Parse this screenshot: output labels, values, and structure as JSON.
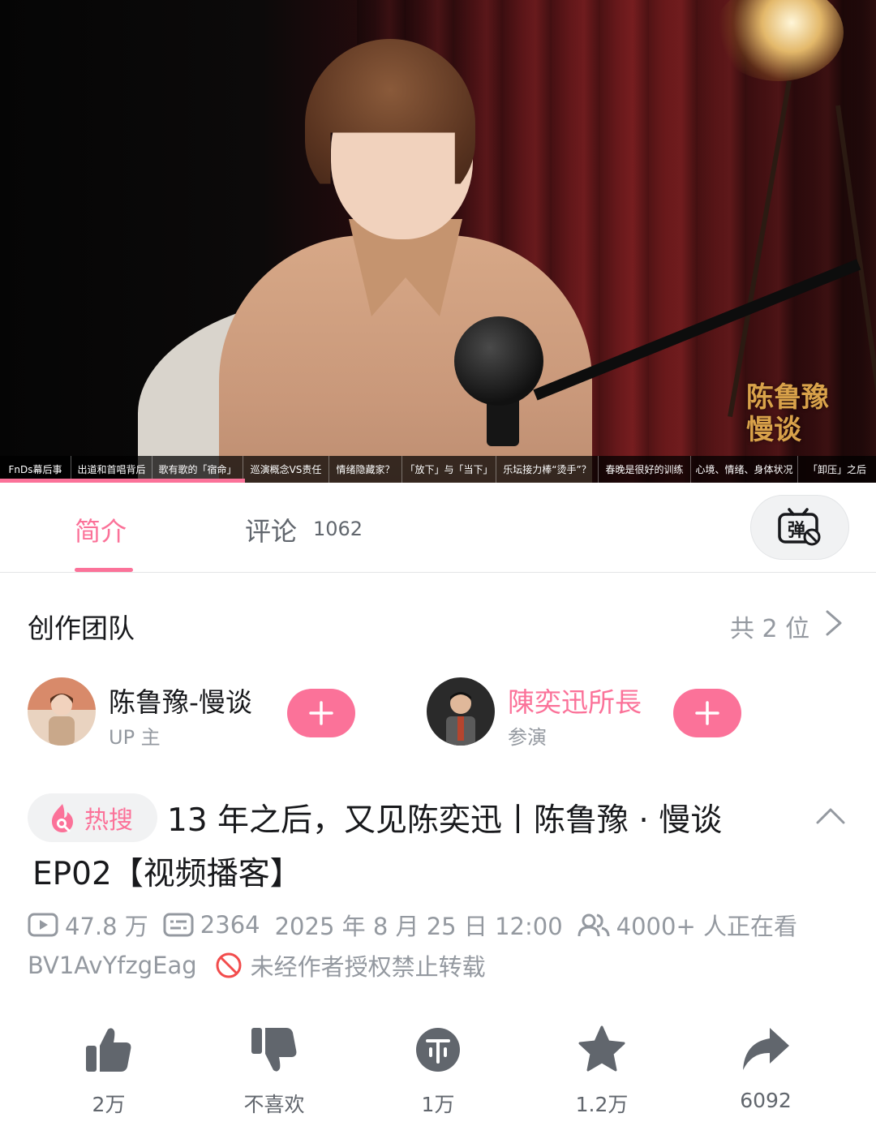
{
  "video": {
    "brand_logo_text": "陈鲁豫慢谈",
    "chapters": [
      {
        "label": "FnDs幕后事",
        "active": true
      },
      {
        "label": "出道和首唱背后",
        "active": false
      },
      {
        "label": "歌有歌的「宿命」",
        "active": false
      },
      {
        "label": "巡演概念VS责任",
        "active": false
      },
      {
        "label": "情绪隐藏家？",
        "active": false
      },
      {
        "label": "「放下」与「当下」",
        "active": false
      },
      {
        "label": "乐坛接力棒“烫手”？",
        "active": false
      },
      {
        "label": "春晚是很好的训练",
        "active": false
      },
      {
        "label": "心境、情绪、身体状况",
        "active": false
      },
      {
        "label": "「卸压」之后",
        "active": false
      }
    ],
    "progress": 0.28
  },
  "tabs": {
    "intro_label": "简介",
    "comments_label": "评论",
    "comments_count": "1062",
    "danmaku_icon": "danmaku-icon"
  },
  "team": {
    "title": "创作团队",
    "count_label": "共 2 位",
    "members": [
      {
        "name": "陈鲁豫-慢谈",
        "role": "UP 主",
        "name_color": "#18191c"
      },
      {
        "name": "陳奕迅所長",
        "role": "参演",
        "name_color": "#fb7299"
      }
    ]
  },
  "title": {
    "hot_tag": "热搜",
    "line1": "13 年之后，又见陈奕迅丨陈鲁豫 · 慢谈",
    "line2": "EP02【视频播客】"
  },
  "stats": {
    "views": "47.8 万",
    "danmaku": "2364",
    "datetime": "2025 年 8 月 25 日 12:00",
    "watching": "4000+ 人正在看",
    "bvid": "BV1AvYfzgEag",
    "notice": "未经作者授权禁止转载"
  },
  "actions": [
    {
      "icon": "thumbs-up-icon",
      "label": "2万"
    },
    {
      "icon": "thumbs-down-icon",
      "label": "不喜欢"
    },
    {
      "icon": "coin-icon",
      "label": "1万"
    },
    {
      "icon": "star-icon",
      "label": "1.2万"
    },
    {
      "icon": "share-icon",
      "label": "6092"
    }
  ],
  "colors": {
    "accent": "#fb7299",
    "text_primary": "#18191c",
    "text_secondary": "#9499a0",
    "icon_gray": "#61666d"
  }
}
